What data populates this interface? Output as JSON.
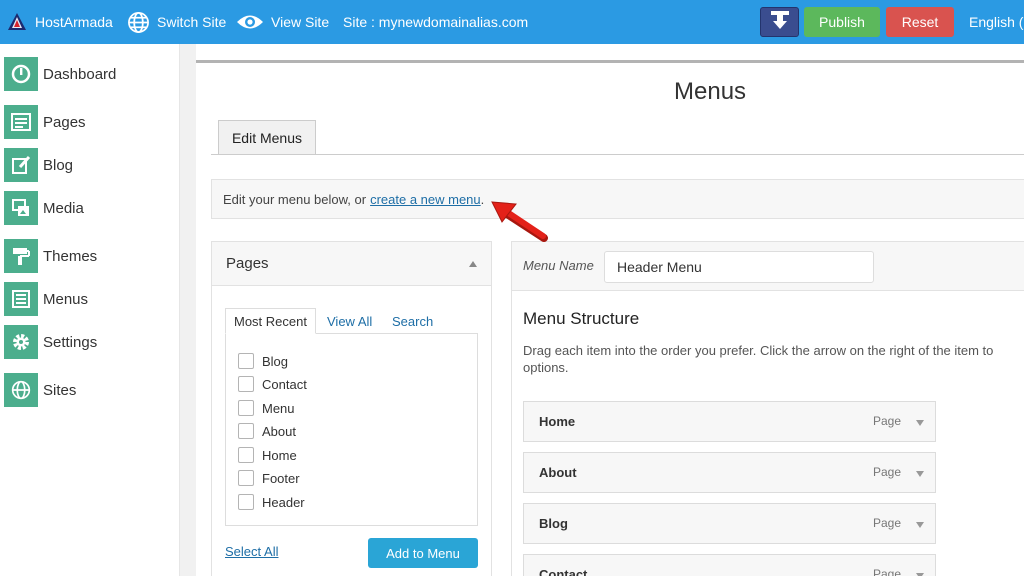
{
  "topbar": {
    "brand": "HostArmada",
    "switch_site": "Switch Site",
    "view_site": "View Site",
    "site": "Site : mynewdomainalias.com",
    "publish": "Publish",
    "reset": "Reset",
    "language": "English (U"
  },
  "sidebar": {
    "items": [
      {
        "label": "Dashboard",
        "icon": "dashboard-icon"
      },
      {
        "label": "Pages",
        "icon": "pages-icon"
      },
      {
        "label": "Blog",
        "icon": "blog-icon"
      },
      {
        "label": "Media",
        "icon": "media-icon"
      },
      {
        "label": "Themes",
        "icon": "themes-icon"
      },
      {
        "label": "Menus",
        "icon": "menus-icon"
      },
      {
        "label": "Settings",
        "icon": "settings-icon"
      },
      {
        "label": "Sites",
        "icon": "sites-icon"
      }
    ]
  },
  "main": {
    "title": "Menus",
    "tab": "Edit Menus",
    "notice_text": "Edit your menu below, or",
    "notice_link": "create a new menu",
    "notice_end": "."
  },
  "pages_panel": {
    "title": "Pages",
    "tabs": [
      "Most Recent",
      "View All",
      "Search"
    ],
    "items": [
      "Blog",
      "Contact",
      "Menu",
      "About",
      "Home",
      "Footer",
      "Header"
    ],
    "select_all": "Select All",
    "add_button": "Add to Menu"
  },
  "menu_panel": {
    "name_label": "Menu Name",
    "name_value": "Header Menu",
    "structure_title": "Menu Structure",
    "structure_desc": "Drag each item into the order you prefer. Click the arrow on the right of the item to",
    "structure_desc2": "options.",
    "items": [
      {
        "title": "Home",
        "type": "Page"
      },
      {
        "title": "About",
        "type": "Page"
      },
      {
        "title": "Blog",
        "type": "Page"
      },
      {
        "title": "Contact",
        "type": "Page"
      }
    ]
  },
  "colors": {
    "topbar": "#2b9ae3",
    "sidebar_icon": "#4cae8d",
    "publish": "#5cb85c",
    "reset": "#d9534f",
    "add_button": "#2aa5d6",
    "arrow": "#e32119"
  }
}
